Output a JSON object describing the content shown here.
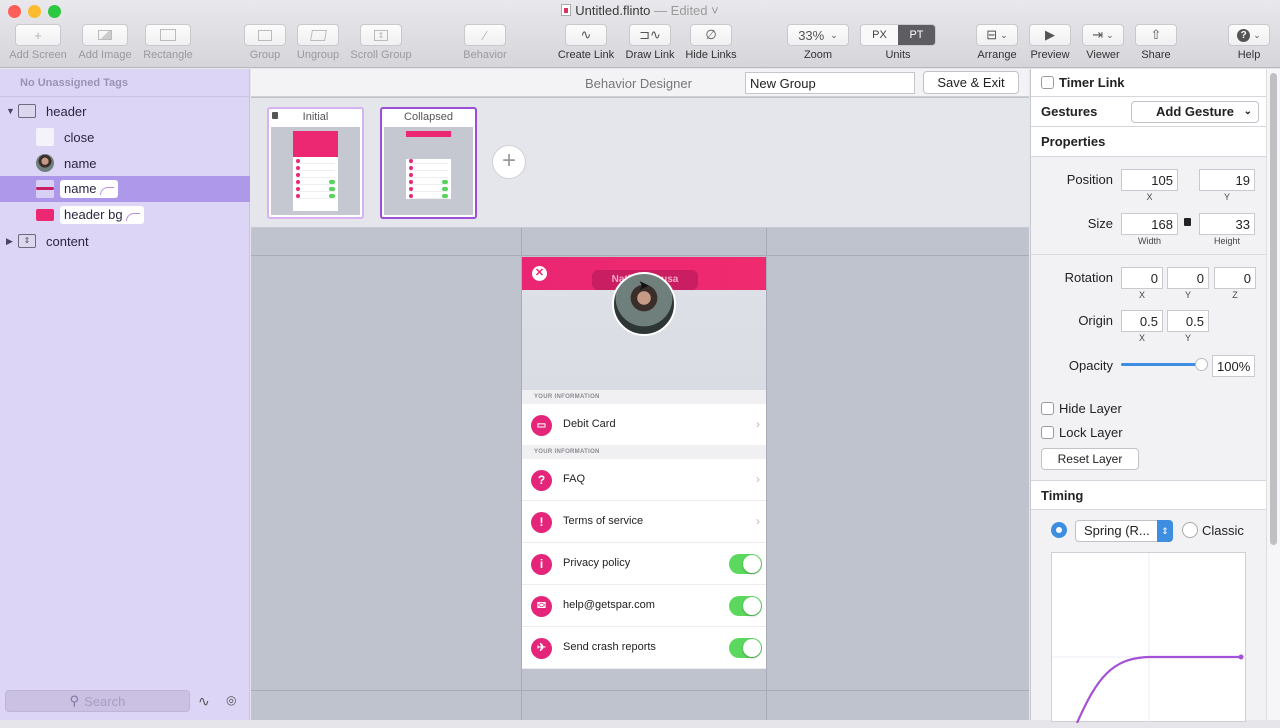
{
  "window": {
    "title": "Untitled.flinto",
    "edited": "— Edited ˅"
  },
  "toolbar": {
    "add_screen": "Add Screen",
    "add_image": "Add Image",
    "rectangle": "Rectangle",
    "group": "Group",
    "ungroup": "Ungroup",
    "scroll_group": "Scroll Group",
    "behavior": "Behavior",
    "create_link": "Create Link",
    "draw_link": "Draw Link",
    "hide_links": "Hide Links",
    "zoom_value": "33%",
    "zoom_label": "Zoom",
    "units_px": "PX",
    "units_pt": "PT",
    "units_selected": "PT",
    "units_label": "Units",
    "arrange": "Arrange",
    "preview": "Preview",
    "viewer": "Viewer",
    "share": "Share",
    "help": "Help"
  },
  "sidebar": {
    "tags_header": "No Unassigned Tags",
    "layers": [
      {
        "name": "header",
        "type": "group",
        "expanded": true
      },
      {
        "name": "close",
        "type": "image"
      },
      {
        "name": "name",
        "type": "image"
      },
      {
        "name": "name",
        "type": "shape",
        "selected": true,
        "animated": true
      },
      {
        "name": "header bg",
        "type": "shape",
        "animated": true
      },
      {
        "name": "content",
        "type": "scroll-group",
        "expanded": false
      }
    ],
    "search_placeholder": "Search"
  },
  "behavior_designer": {
    "title": "Behavior Designer",
    "group_name": "New Group",
    "save_exit": "Save & Exit",
    "states": [
      {
        "name": "Initial",
        "locked": true
      },
      {
        "name": "Collapsed",
        "active": true
      }
    ]
  },
  "phone": {
    "name_pill": "Nathan Sousa",
    "section1": "YOUR INFORMATION",
    "section2": "YOUR INFORMATION",
    "rows": [
      {
        "label": "Debit Card",
        "icon": "card-icon",
        "control": "chevron"
      },
      {
        "label": "FAQ",
        "icon": "question-icon",
        "control": "chevron"
      },
      {
        "label": "Terms of service",
        "icon": "exclamation-icon",
        "control": "chevron"
      },
      {
        "label": "Privacy policy",
        "icon": "info-icon",
        "control": "toggle",
        "on": true
      },
      {
        "label": "help@getspar.com",
        "icon": "mail-icon",
        "control": "toggle",
        "on": true
      },
      {
        "label": "Send crash reports",
        "icon": "plane-icon",
        "control": "toggle",
        "on": true
      }
    ]
  },
  "inspector": {
    "timer_link": "Timer Link",
    "gestures": "Gestures",
    "add_gesture": "Add Gesture",
    "properties": "Properties",
    "position_label": "Position",
    "position_x": "105",
    "position_y": "19",
    "x": "X",
    "y": "Y",
    "z": "Z",
    "size_label": "Size",
    "width_value": "168",
    "height_value": "33",
    "width_label": "Width",
    "height_label": "Height",
    "rotation_label": "Rotation",
    "rotation_x": "0",
    "rotation_y": "0",
    "rotation_z": "0",
    "origin_label": "Origin",
    "origin_x": "0.5",
    "origin_y": "0.5",
    "opacity_label": "Opacity",
    "opacity_value": "100%",
    "opacity_fraction": 1.0,
    "hide_layer": "Hide Layer",
    "lock_layer": "Lock Layer",
    "reset_layer": "Reset Layer",
    "timing": "Timing",
    "timing_mode": "Spring (R...",
    "classic": "Classic"
  },
  "colors": {
    "accent_pink": "#ec2872",
    "selection": "#ae98ea",
    "toggle_on": "#5cd85f",
    "curve": "#a450d8",
    "sidebar_bg": "#ddd5f6"
  }
}
